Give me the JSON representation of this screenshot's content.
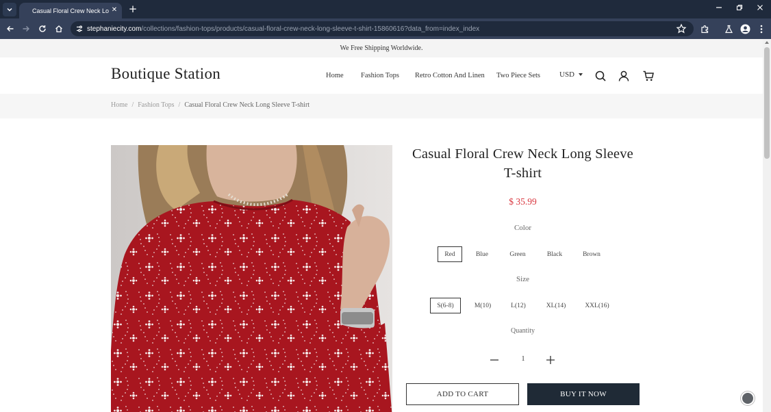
{
  "browser": {
    "tab_title": "Casual Floral Crew Neck Long S",
    "url_host": "stephaniecity.com",
    "url_path": "/collections/fashion-tops/products/casual-floral-crew-neck-long-sleeve-t-shirt-15860616?data_from=index_index"
  },
  "announcement": "We Free Shipping Worldwide.",
  "header": {
    "logo": "Boutique Station",
    "nav": [
      "Home",
      "Fashion Tops",
      "Retro Cotton And Linen",
      "Two Piece Sets"
    ],
    "currency": "USD"
  },
  "breadcrumb": {
    "home": "Home",
    "category": "Fashion Tops",
    "current": "Casual Floral Crew Neck Long Sleeve T-shirt",
    "separator": "/"
  },
  "product": {
    "title": "Casual Floral Crew Neck Long Sleeve T-shirt",
    "price": "$ 35.99",
    "color_label": "Color",
    "colors": [
      "Red",
      "Blue",
      "Green",
      "Black",
      "Brown"
    ],
    "selected_color": "Red",
    "size_label": "Size",
    "sizes": [
      "S(6-8)",
      "M(10)",
      "L(12)",
      "XL(14)",
      "XXL(16)"
    ],
    "selected_size": "S(6-8)",
    "quantity_label": "Quantity",
    "quantity": "1",
    "add_to_cart": "ADD TO CART",
    "buy_now": "BUY IT NOW"
  },
  "colors": {
    "chrome_dark": "#1f2a3c",
    "chrome_toolbar": "#35415a",
    "price_red": "#d9363e",
    "buy_button": "#1f2a36",
    "shirt_red": "#a8161f"
  },
  "icons": {
    "header": [
      "search-icon",
      "account-icon",
      "cart-icon"
    ],
    "browser": [
      "back-icon",
      "forward-icon",
      "reload-icon",
      "home-icon",
      "site-info-icon",
      "star-icon",
      "extensions-icon",
      "labs-icon",
      "profile-icon",
      "menu-icon"
    ]
  }
}
